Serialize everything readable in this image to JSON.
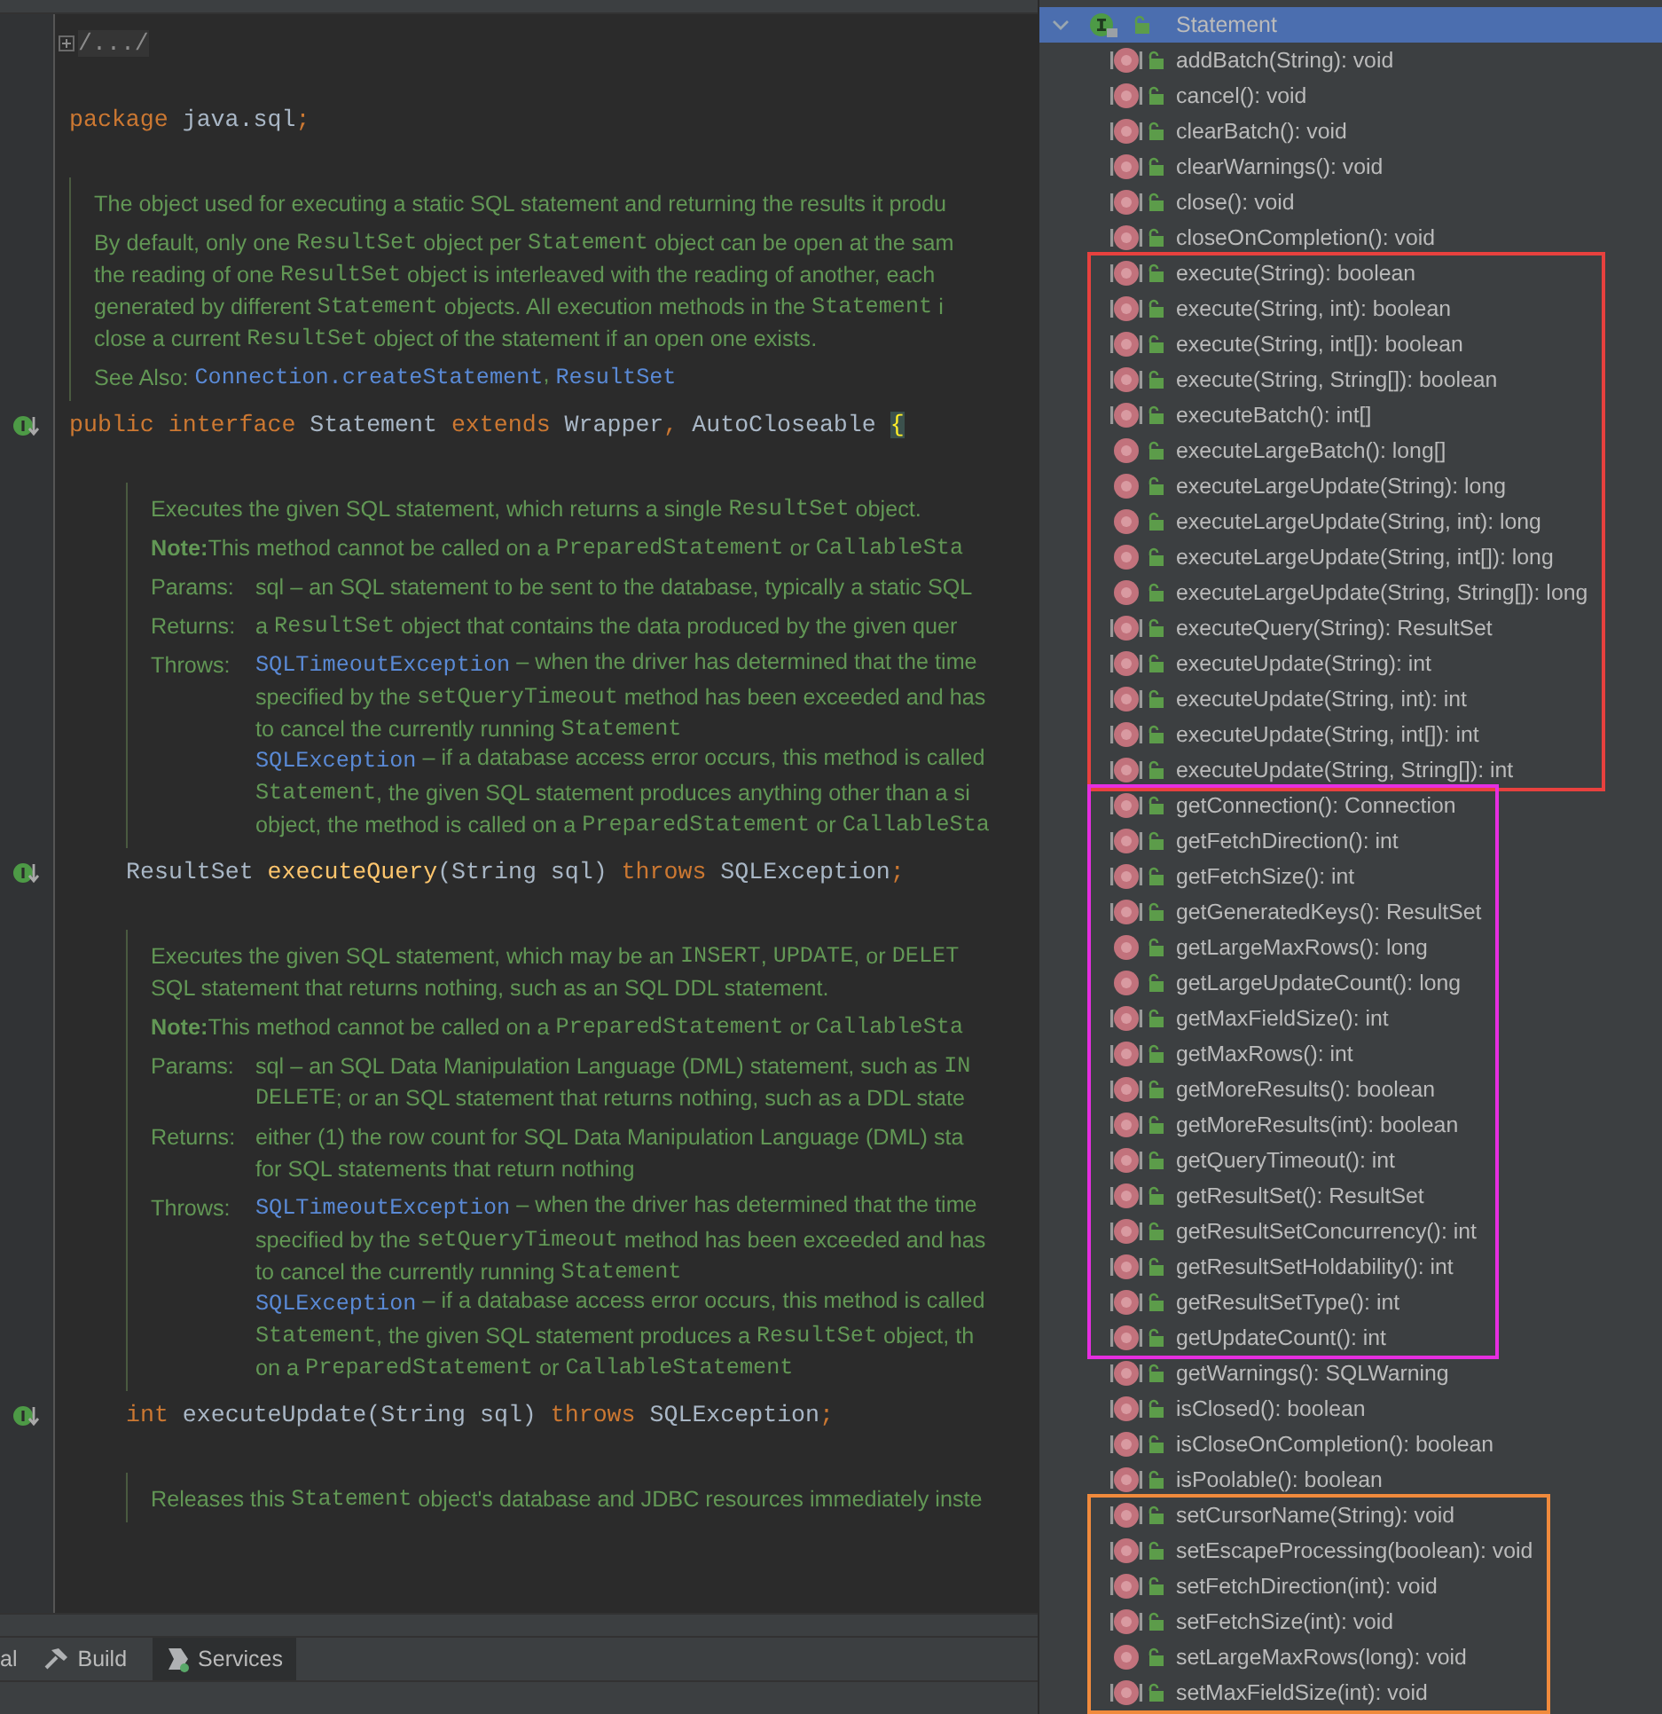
{
  "editor": {
    "items": [
      {
        "kind": "fold",
        "text": "/.../"
      },
      {
        "kind": "code",
        "gutter_marker": false,
        "tokens": [
          {
            "kind": "kw",
            "t": "package "
          },
          {
            "kind": "id",
            "t": "java.sql"
          },
          {
            "kind": "kw",
            "t": ";"
          }
        ]
      },
      {
        "kind": "doc",
        "entries": [
          {
            "lines": [
              [
                {
                  "kind": "plain",
                  "t": "The object used for executing a static SQL statement and returning the results it produ"
                }
              ]
            ]
          },
          {
            "lines": [
              [
                {
                  "kind": "plain",
                  "t": "By default, only one "
                },
                {
                  "kind": "code",
                  "t": "ResultSet"
                },
                {
                  "kind": "plain",
                  "t": " object per "
                },
                {
                  "kind": "code",
                  "t": "Statement"
                },
                {
                  "kind": "plain",
                  "t": " object can be open at the sam"
                }
              ],
              [
                {
                  "kind": "plain",
                  "t": "the reading of one "
                },
                {
                  "kind": "code",
                  "t": "ResultSet"
                },
                {
                  "kind": "plain",
                  "t": " object is interleaved with the reading of another, each"
                }
              ],
              [
                {
                  "kind": "plain",
                  "t": "generated by different "
                },
                {
                  "kind": "code",
                  "t": "Statement"
                },
                {
                  "kind": "plain",
                  "t": " objects. All execution methods in the "
                },
                {
                  "kind": "code",
                  "t": "Statement"
                },
                {
                  "kind": "plain",
                  "t": " i"
                }
              ],
              [
                {
                  "kind": "plain",
                  "t": "close a current "
                },
                {
                  "kind": "code",
                  "t": "ResultSet"
                },
                {
                  "kind": "plain",
                  "t": " object of the statement if an open one exists."
                }
              ]
            ]
          },
          {
            "lines": [
              [
                {
                  "kind": "plain",
                  "t": "See Also: "
                },
                {
                  "kind": "link",
                  "t": "Connection.createStatement"
                },
                {
                  "kind": "plain",
                  "t": ", "
                },
                {
                  "kind": "link",
                  "t": "ResultSet"
                }
              ]
            ]
          }
        ]
      },
      {
        "kind": "code",
        "gutter_marker": true,
        "tokens": [
          {
            "kind": "kw",
            "t": "public interface "
          },
          {
            "kind": "id",
            "t": "Statement "
          },
          {
            "kind": "kw",
            "t": "extends "
          },
          {
            "kind": "id",
            "t": "Wrapper"
          },
          {
            "kind": "kw",
            "t": ", "
          },
          {
            "kind": "id",
            "t": "AutoCloseable "
          },
          {
            "kind": "brace",
            "t": "{"
          }
        ],
        "children": [
          {
            "kind": "doc",
            "entries": [
              {
                "lines": [
                  [
                    {
                      "kind": "plain",
                      "t": "Executes the given SQL statement, which returns a single "
                    },
                    {
                      "kind": "code",
                      "t": "ResultSet"
                    },
                    {
                      "kind": "plain",
                      "t": " object."
                    }
                  ]
                ]
              },
              {
                "lines": [
                  [
                    {
                      "kind": "bold",
                      "t": "Note:"
                    },
                    {
                      "kind": "plain",
                      "t": "This method cannot be called on a "
                    },
                    {
                      "kind": "code",
                      "t": "PreparedStatement"
                    },
                    {
                      "kind": "plain",
                      "t": " or "
                    },
                    {
                      "kind": "code",
                      "t": "CallableSta"
                    }
                  ]
                ]
              },
              {
                "label": "Params:",
                "lines": [
                  [
                    {
                      "kind": "plain",
                      "t": "sql – an SQL statement to be sent to the database, typically a static SQL"
                    }
                  ]
                ]
              },
              {
                "label": "Returns:",
                "lines": [
                  [
                    {
                      "kind": "plain",
                      "t": "a "
                    },
                    {
                      "kind": "code",
                      "t": "ResultSet"
                    },
                    {
                      "kind": "plain",
                      "t": " object that contains the data produced by the given quer"
                    }
                  ]
                ]
              },
              {
                "label": "Throws:",
                "lines": [
                  [
                    {
                      "kind": "link",
                      "t": "SQLTimeoutException"
                    },
                    {
                      "kind": "plain",
                      "t": " – when the driver has determined that the time"
                    }
                  ],
                  [
                    {
                      "kind": "plain",
                      "t": "specified by the "
                    },
                    {
                      "kind": "code",
                      "t": "setQueryTimeout"
                    },
                    {
                      "kind": "plain",
                      "t": " method has been exceeded and has"
                    }
                  ],
                  [
                    {
                      "kind": "plain",
                      "t": "to cancel the currently running "
                    },
                    {
                      "kind": "code",
                      "t": "Statement"
                    }
                  ],
                  [
                    {
                      "kind": "link",
                      "t": "SQLException"
                    },
                    {
                      "kind": "plain",
                      "t": " – if a database access error occurs, this method is called"
                    }
                  ],
                  [
                    {
                      "kind": "code",
                      "t": "Statement"
                    },
                    {
                      "kind": "plain",
                      "t": ", the given SQL statement produces anything other than a si"
                    }
                  ],
                  [
                    {
                      "kind": "plain",
                      "t": "object, the method is called on a "
                    },
                    {
                      "kind": "code",
                      "t": "PreparedStatement"
                    },
                    {
                      "kind": "plain",
                      "t": " or "
                    },
                    {
                      "kind": "code",
                      "t": "CallableSta"
                    }
                  ]
                ]
              }
            ]
          },
          {
            "kind": "code",
            "gutter_marker": true,
            "tokens": [
              {
                "kind": "id",
                "t": "ResultSet "
              },
              {
                "kind": "fn",
                "t": "executeQuery"
              },
              {
                "kind": "id",
                "t": "(String sql) "
              },
              {
                "kind": "kw",
                "t": "throws "
              },
              {
                "kind": "id",
                "t": "SQLException"
              },
              {
                "kind": "kw",
                "t": ";"
              }
            ]
          },
          {
            "kind": "doc",
            "entries": [
              {
                "lines": [
                  [
                    {
                      "kind": "plain",
                      "t": "Executes the given SQL statement, which may be an "
                    },
                    {
                      "kind": "code",
                      "t": "INSERT"
                    },
                    {
                      "kind": "plain",
                      "t": ", "
                    },
                    {
                      "kind": "code",
                      "t": "UPDATE"
                    },
                    {
                      "kind": "plain",
                      "t": ", or "
                    },
                    {
                      "kind": "code",
                      "t": "DELET"
                    }
                  ],
                  [
                    {
                      "kind": "plain",
                      "t": "SQL statement that returns nothing, such as an SQL DDL statement."
                    }
                  ]
                ]
              },
              {
                "lines": [
                  [
                    {
                      "kind": "bold",
                      "t": "Note:"
                    },
                    {
                      "kind": "plain",
                      "t": "This method cannot be called on a "
                    },
                    {
                      "kind": "code",
                      "t": "PreparedStatement"
                    },
                    {
                      "kind": "plain",
                      "t": " or "
                    },
                    {
                      "kind": "code",
                      "t": "CallableSta"
                    }
                  ]
                ]
              },
              {
                "label": "Params:",
                "lines": [
                  [
                    {
                      "kind": "plain",
                      "t": "sql – an SQL Data Manipulation Language (DML) statement, such as "
                    },
                    {
                      "kind": "code",
                      "t": "IN"
                    }
                  ],
                  [
                    {
                      "kind": "code",
                      "t": "DELETE"
                    },
                    {
                      "kind": "plain",
                      "t": "; or an SQL statement that returns nothing, such as a DDL state"
                    }
                  ]
                ]
              },
              {
                "label": "Returns:",
                "lines": [
                  [
                    {
                      "kind": "plain",
                      "t": "either (1) the row count for SQL Data Manipulation Language (DML) sta"
                    }
                  ],
                  [
                    {
                      "kind": "plain",
                      "t": "for SQL statements that return nothing"
                    }
                  ]
                ]
              },
              {
                "label": "Throws:",
                "lines": [
                  [
                    {
                      "kind": "link",
                      "t": "SQLTimeoutException"
                    },
                    {
                      "kind": "plain",
                      "t": " – when the driver has determined that the time"
                    }
                  ],
                  [
                    {
                      "kind": "plain",
                      "t": "specified by the "
                    },
                    {
                      "kind": "code",
                      "t": "setQueryTimeout"
                    },
                    {
                      "kind": "plain",
                      "t": " method has been exceeded and has"
                    }
                  ],
                  [
                    {
                      "kind": "plain",
                      "t": "to cancel the currently running "
                    },
                    {
                      "kind": "code",
                      "t": "Statement"
                    }
                  ],
                  [
                    {
                      "kind": "link",
                      "t": "SQLException"
                    },
                    {
                      "kind": "plain",
                      "t": " – if a database access error occurs, this method is called"
                    }
                  ],
                  [
                    {
                      "kind": "code",
                      "t": "Statement"
                    },
                    {
                      "kind": "plain",
                      "t": ", the given SQL statement produces a "
                    },
                    {
                      "kind": "code",
                      "t": "ResultSet"
                    },
                    {
                      "kind": "plain",
                      "t": " object, th"
                    }
                  ],
                  [
                    {
                      "kind": "plain",
                      "t": "on a "
                    },
                    {
                      "kind": "code",
                      "t": "PreparedStatement"
                    },
                    {
                      "kind": "plain",
                      "t": " or "
                    },
                    {
                      "kind": "code",
                      "t": "CallableStatement"
                    }
                  ]
                ]
              }
            ]
          },
          {
            "kind": "code",
            "gutter_marker": true,
            "tokens": [
              {
                "kind": "kw",
                "t": "int "
              },
              {
                "kind": "id",
                "t": "executeUpdate(String sql) "
              },
              {
                "kind": "kw",
                "t": "throws "
              },
              {
                "kind": "id",
                "t": "SQLException"
              },
              {
                "kind": "kw",
                "t": ";"
              }
            ]
          },
          {
            "kind": "doc",
            "entries": [
              {
                "lines": [
                  [
                    {
                      "kind": "plain",
                      "t": "Releases this "
                    },
                    {
                      "kind": "code",
                      "t": "Statement"
                    },
                    {
                      "kind": "plain",
                      "t": " object's database and JDBC resources immediately inste"
                    }
                  ]
                ]
              }
            ]
          }
        ]
      }
    ]
  },
  "tool_tabs": [
    {
      "kind": "plain",
      "label": "al",
      "selected": false
    },
    {
      "kind": "build",
      "label": "Build",
      "selected": false
    },
    {
      "kind": "services",
      "label": "Services",
      "selected": true
    }
  ],
  "structure": {
    "label": "Statement",
    "selected": true,
    "expanded": true,
    "groups": [
      {
        "children": [
          {
            "label": "addBatch(String): void",
            "abstract": true
          },
          {
            "label": "cancel(): void",
            "abstract": true
          },
          {
            "label": "clearBatch(): void",
            "abstract": true
          },
          {
            "label": "clearWarnings(): void",
            "abstract": true
          },
          {
            "label": "close(): void",
            "abstract": true
          },
          {
            "label": "closeOnCompletion(): void",
            "abstract": true
          }
        ]
      },
      {
        "color": "#e8413e",
        "children": [
          {
            "label": "execute(String): boolean",
            "abstract": true
          },
          {
            "label": "execute(String, int): boolean",
            "abstract": true
          },
          {
            "label": "execute(String, int[]): boolean",
            "abstract": true
          },
          {
            "label": "execute(String, String[]): boolean",
            "abstract": true
          },
          {
            "label": "executeBatch(): int[]",
            "abstract": true
          },
          {
            "label": "executeLargeBatch(): long[]",
            "abstract": false
          },
          {
            "label": "executeLargeUpdate(String): long",
            "abstract": false
          },
          {
            "label": "executeLargeUpdate(String, int): long",
            "abstract": false
          },
          {
            "label": "executeLargeUpdate(String, int[]): long",
            "abstract": false
          },
          {
            "label": "executeLargeUpdate(String, String[]): long",
            "abstract": false
          },
          {
            "label": "executeQuery(String): ResultSet",
            "abstract": true
          },
          {
            "label": "executeUpdate(String): int",
            "abstract": true
          },
          {
            "label": "executeUpdate(String, int): int",
            "abstract": true
          },
          {
            "label": "executeUpdate(String, int[]): int",
            "abstract": true
          },
          {
            "label": "executeUpdate(String, String[]): int",
            "abstract": true
          }
        ]
      },
      {
        "color": "#e62ee0",
        "children": [
          {
            "label": "getConnection(): Connection",
            "abstract": true
          },
          {
            "label": "getFetchDirection(): int",
            "abstract": true
          },
          {
            "label": "getFetchSize(): int",
            "abstract": true
          },
          {
            "label": "getGeneratedKeys(): ResultSet",
            "abstract": true
          },
          {
            "label": "getLargeMaxRows(): long",
            "abstract": false
          },
          {
            "label": "getLargeUpdateCount(): long",
            "abstract": false
          },
          {
            "label": "getMaxFieldSize(): int",
            "abstract": true
          },
          {
            "label": "getMaxRows(): int",
            "abstract": true
          },
          {
            "label": "getMoreResults(): boolean",
            "abstract": true
          },
          {
            "label": "getMoreResults(int): boolean",
            "abstract": true
          },
          {
            "label": "getQueryTimeout(): int",
            "abstract": true
          },
          {
            "label": "getResultSet(): ResultSet",
            "abstract": true
          },
          {
            "label": "getResultSetConcurrency(): int",
            "abstract": true
          },
          {
            "label": "getResultSetHoldability(): int",
            "abstract": true
          },
          {
            "label": "getResultSetType(): int",
            "abstract": true
          },
          {
            "label": "getUpdateCount(): int",
            "abstract": true
          }
        ]
      },
      {
        "children": [
          {
            "label": "getWarnings(): SQLWarning",
            "abstract": true
          },
          {
            "label": "isClosed(): boolean",
            "abstract": true
          },
          {
            "label": "isCloseOnCompletion(): boolean",
            "abstract": true
          },
          {
            "label": "isPoolable(): boolean",
            "abstract": true
          }
        ]
      },
      {
        "color": "#f08a3c",
        "children": [
          {
            "label": "setCursorName(String): void",
            "abstract": true
          },
          {
            "label": "setEscapeProcessing(boolean): void",
            "abstract": true
          },
          {
            "label": "setFetchDirection(int): void",
            "abstract": true
          },
          {
            "label": "setFetchSize(int): void",
            "abstract": true
          },
          {
            "label": "setLargeMaxRows(long): void",
            "abstract": false
          },
          {
            "label": "setMaxFieldSize(int): void",
            "abstract": true
          }
        ]
      }
    ]
  }
}
